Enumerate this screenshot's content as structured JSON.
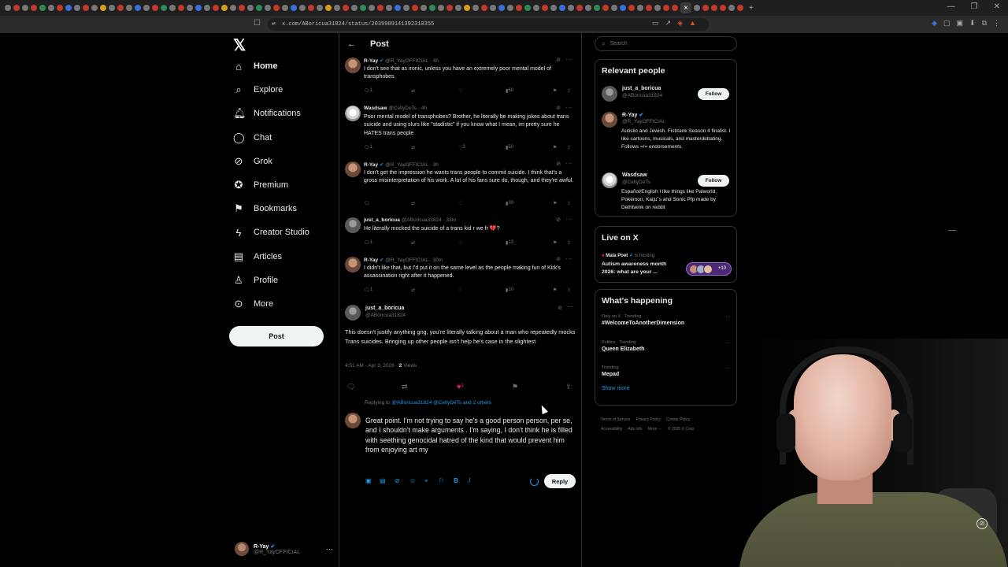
{
  "browser": {
    "url": "x.com/ABoricua31824/status/2039989141392310355"
  },
  "nav": {
    "items": [
      {
        "label": "Home"
      },
      {
        "label": "Explore"
      },
      {
        "label": "Notifications"
      },
      {
        "label": "Chat"
      },
      {
        "label": "Grok"
      },
      {
        "label": "Premium"
      },
      {
        "label": "Bookmarks"
      },
      {
        "label": "Creator Studio"
      },
      {
        "label": "Articles"
      },
      {
        "label": "Profile"
      },
      {
        "label": "More"
      }
    ],
    "post_label": "Post",
    "account": {
      "name": "R-Yay",
      "handle": "@R_YayOFFICIAL"
    }
  },
  "header": {
    "title": "Post"
  },
  "thread": [
    {
      "name": "R-Yay",
      "handle": "@R_YayOFFICIAL",
      "time": "· 4h",
      "text": "I don't see that as ironic, unless you have an extremely poor mental model of transphobes.",
      "replies": "1",
      "retweets": "",
      "likes": "",
      "views": "68"
    },
    {
      "name": "Wasdsaw",
      "handle": "@CellyDeTs",
      "time": "· 4h",
      "text": "Poor mental model of transphobes? Brother, he literally be making jokes about trans suicide and using slurs like \"stadistic\" if you know what I mean, im pretty sure he HATES trans people",
      "replies": "1",
      "retweets": "",
      "likes": "3",
      "views": "50"
    },
    {
      "name": "R-Yay",
      "handle": "@R_YayOFFICIAL",
      "time": "· 3h",
      "text": "I don't get the impression he wants trans people to commit suicide. I think that's a gross misinterpretation of his work. A lot of his fans sure do, though, and they're awful.",
      "replies": "",
      "retweets": "",
      "likes": "",
      "views": "39"
    },
    {
      "name": "just_a_boricua",
      "handle": "@ABoricua31824",
      "time": "· 33m",
      "text": "He literally mocked the suicide of a trans kid r we fr 💔?",
      "replies": "1",
      "retweets": "",
      "likes": "",
      "views": "13"
    },
    {
      "name": "R-Yay",
      "handle": "@R_YayOFFICIAL",
      "time": "· 30m",
      "text": "I didn't like that, but I'd put it on the same level as the people making fun of Kirk's assassination right after it happened.",
      "replies": "1",
      "retweets": "",
      "likes": "",
      "views": "10"
    }
  ],
  "main_post": {
    "name": "just_a_boricua",
    "handle": "@ABoricua31824",
    "text": "This doesn't justify anything gng, you're literally talking about a man who repeatedly mocks Trans suicides. Bringing up other people isn't help he's case in the slightest",
    "timestamp": "4:51 AM · Apr 3, 2026 · ",
    "views_count": "2",
    "views_label": " Views",
    "likes": "1"
  },
  "reply": {
    "replying_prefix": "Replying to ",
    "replying_to": "@ABoricua31824 @CellyDeTs and 2 others",
    "draft": "Great point. I'm not trying to say he's a good person person, per se, and I shouldn't make arguments . I'm saying, I don't think he is filled with seething genocidal hatred of the kind that would prevent him from enjoying art my",
    "button": "Reply"
  },
  "sidebar": {
    "search_placeholder": "Search",
    "relevant_title": "Relevant people",
    "people": [
      {
        "name": "just_a_boricua",
        "handle": "@ABoricua31824",
        "bio": "",
        "follow": "Follow"
      },
      {
        "name": "R-Yay",
        "handle": "@R_YayOFFICIAL",
        "bio": "Autistic and Jewish. Fishtank Season 4 finalist. I like cartoons, musicals, and masterdebating. Follows =/= endorsements.",
        "follow": ""
      },
      {
        "name": "Wasdsaw",
        "handle": "@CellyDeTs",
        "bio": "Español/English I like things like Palworld, Pokémon, Kaiju´s and Sonic Pfp made by Dethtwink on reddit",
        "follow": "Follow"
      }
    ],
    "live": {
      "title": "Live on X",
      "host": "Mala Poet",
      "host_suffix": "is hosting",
      "space_title": "Autism awareness month 2026: what are your ...",
      "listeners": "+10"
    },
    "happening": {
      "title": "What's happening",
      "trends": [
        {
          "context": "Only on X · Trending",
          "name": "#WelcomeToAnotherDimension"
        },
        {
          "context": "Politics · Trending",
          "name": "Queen Elizabeth"
        },
        {
          "context": "Trending",
          "name": "Mepad"
        }
      ],
      "show_more": "Show more"
    },
    "footer": [
      "Terms of Service",
      "Privacy Policy",
      "Cookie Policy",
      "Accessibility",
      "Ads info",
      "More ···",
      "© 2026 X Corp."
    ]
  },
  "colors": {
    "accent": "#1d9bf0",
    "like": "#f91880",
    "background": "#000000"
  }
}
